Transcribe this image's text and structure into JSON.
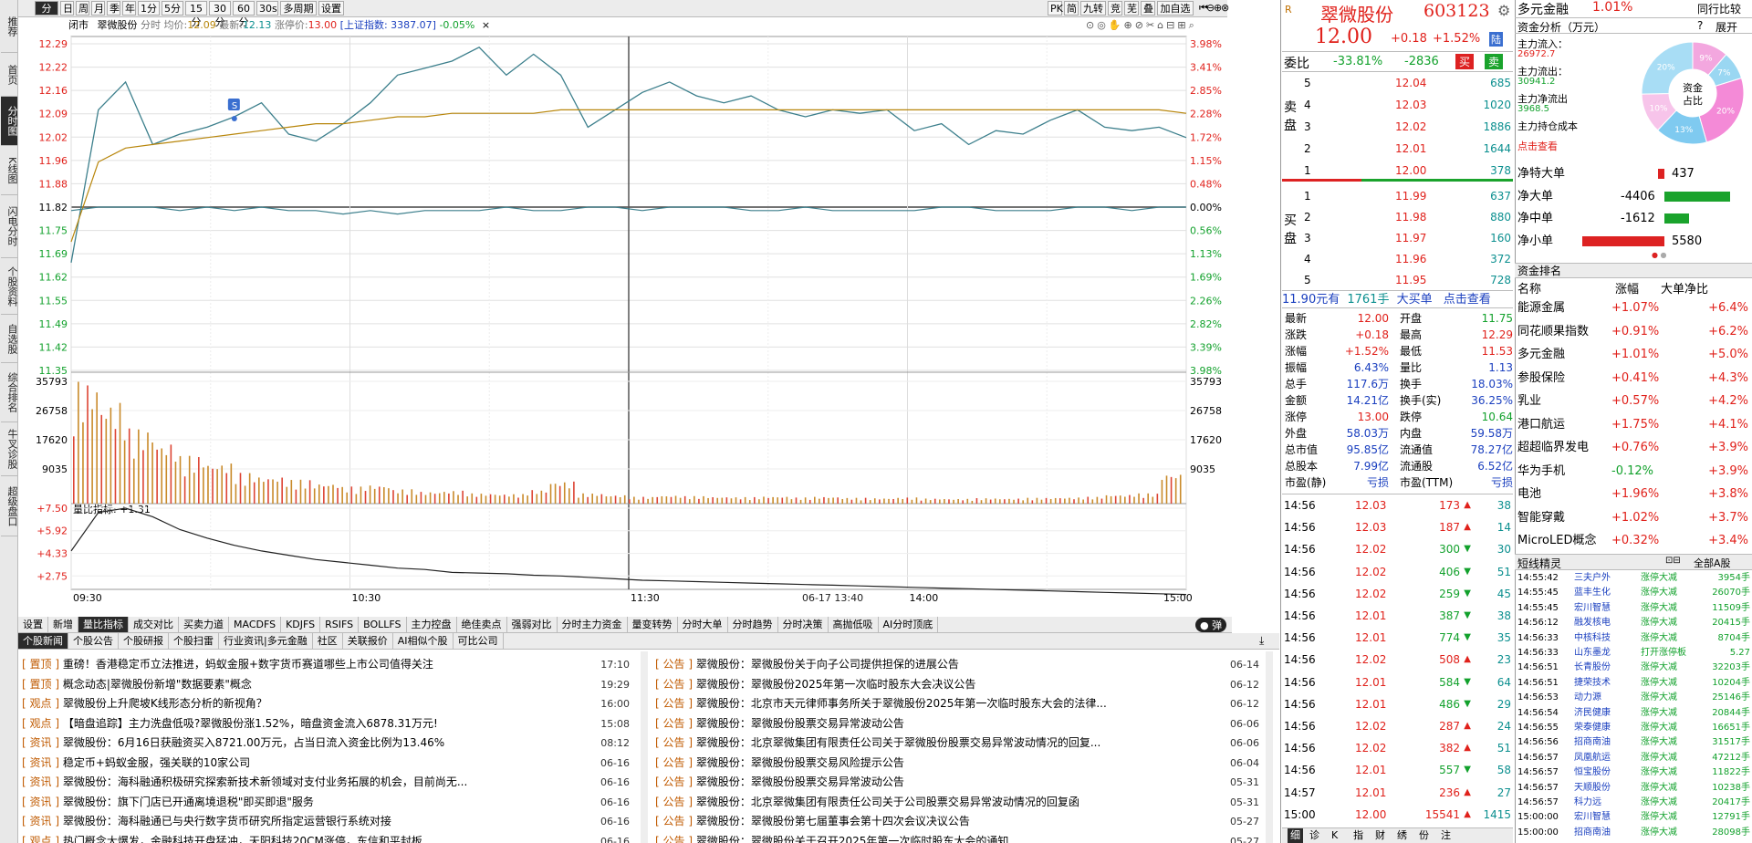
{
  "nav": {
    "tabs": [
      "推荐",
      "首页",
      "分时图",
      "K线图",
      "闪电分时",
      "个股资料",
      "自选股",
      "综合排名",
      "牛叉诊股",
      "超级盘口"
    ],
    "active": 2
  },
  "toolbar": {
    "periods": [
      "分时",
      "日",
      "周",
      "月",
      "季",
      "年",
      "1分",
      "5分",
      "15分",
      "30分",
      "60分",
      "30s",
      "多周期",
      "设置"
    ],
    "right": [
      "PK",
      "简",
      "九转",
      "竞",
      "芜",
      "叠",
      "加自选"
    ]
  },
  "chart_header": {
    "status": "闭市",
    "name": "翠微股份",
    "type": "分时",
    "avg_label": "均价:",
    "avg": "12.09",
    "last_label": "最新:",
    "last": "12.13",
    "limit_label": "涨停价:",
    "limit": "13.00",
    "index_text": "[上证指数: 3387.07]",
    "index_chg": "-0.05%",
    "close": "×"
  },
  "chart_data": [
    {
      "type": "line",
      "title": "分时",
      "x": [
        "09:30",
        "10:30",
        "11:30",
        "14:00",
        "15:00"
      ],
      "left_ticks": [
        "12.29",
        "12.22",
        "12.16",
        "12.09",
        "12.02",
        "11.96",
        "11.88",
        "11.82",
        "11.75",
        "11.69",
        "11.62",
        "11.55",
        "11.49",
        "11.42",
        "11.35"
      ],
      "right_ticks": [
        "3.98%",
        "3.41%",
        "2.85%",
        "2.28%",
        "1.72%",
        "1.15%",
        "0.48%",
        "0.00%",
        "0.56%",
        "1.13%",
        "1.69%",
        "2.26%",
        "2.82%",
        "3.39%",
        "3.98%"
      ],
      "ylim": [
        11.35,
        12.29
      ],
      "series": [
        {
          "name": "",
          "values": [
            11.66,
            12.1,
            12.18,
            12.0,
            12.03,
            12.05,
            12.08,
            12.12,
            12.03,
            12.01,
            12.06,
            12.12,
            12.2,
            12.22,
            12.24,
            12.28,
            12.2,
            12.26,
            12.2,
            12.05,
            12.1,
            12.15,
            12.18,
            12.14,
            12.12,
            12.14,
            12.1,
            12.08,
            12.1,
            12.09,
            12.1,
            12.04,
            12.06,
            12.0,
            12.04,
            12.03,
            12.07,
            12.1,
            12.05,
            12.04,
            12.05,
            12.02
          ]
        },
        {
          "name": "",
          "values": [
            11.72,
            11.95,
            11.99,
            12.0,
            12.01,
            12.02,
            12.03,
            12.04,
            12.05,
            12.06,
            12.06,
            12.07,
            12.08,
            12.08,
            12.09,
            12.09,
            12.09,
            12.09,
            12.1,
            12.1,
            12.1,
            12.1,
            12.1,
            12.1,
            12.1,
            12.1,
            12.1,
            12.1,
            12.1,
            12.1,
            12.1,
            12.1,
            12.1,
            12.1,
            12.1,
            12.1,
            12.1,
            12.1,
            12.1,
            12.1,
            12.1,
            12.09
          ]
        },
        {
          "name": "",
          "values": [
            11.81,
            11.82,
            11.82,
            11.82,
            11.81,
            11.82,
            11.81,
            11.82,
            11.81,
            11.81,
            11.8,
            11.81,
            11.8,
            11.81,
            11.81,
            11.81,
            11.82,
            11.81,
            11.81,
            11.82,
            11.82,
            11.81,
            11.82,
            11.82,
            11.82,
            11.81,
            11.81,
            11.82,
            11.81,
            11.81,
            11.81,
            11.81,
            11.82,
            11.82,
            11.81,
            11.81,
            11.81,
            11.82,
            11.82,
            11.81,
            11.82,
            11.82
          ]
        }
      ],
      "marker": "S"
    },
    {
      "type": "bar",
      "title": "成交量",
      "left_ticks": [
        "35793",
        "26758",
        "17620",
        "9035"
      ],
      "right_ticks": [
        "35793",
        "26758",
        "17620",
        "9035"
      ],
      "values": [
        35793,
        30000,
        22000,
        18000,
        14000,
        12000,
        9000,
        8000,
        7000,
        6000,
        5000,
        5500,
        4200,
        3500,
        3800,
        3000,
        2800,
        4000,
        6500,
        3000,
        2500,
        2000,
        2400,
        2200,
        2000,
        1900,
        2100,
        1800,
        2000,
        1700,
        1600,
        1800,
        1500,
        1400,
        1600,
        1500,
        1700,
        1800,
        2000,
        2600,
        3000,
        9000
      ]
    },
    {
      "type": "line",
      "title": "量比指标",
      "label": "量比指标: +1.31",
      "ticks": [
        "+7.50",
        "+5.92",
        "+4.33",
        "+2.75"
      ],
      "values": [
        4.5,
        7.2,
        7.5,
        6.9,
        6.0,
        5.4,
        4.9,
        4.5,
        4.2,
        3.9,
        3.7,
        3.5,
        3.3,
        3.2,
        3.0,
        2.95,
        2.9,
        2.8,
        2.75,
        2.65,
        2.55,
        2.45,
        2.4,
        2.35,
        2.3,
        2.25,
        2.2,
        2.15,
        2.1,
        2.05,
        2.0,
        1.95,
        1.9,
        1.85,
        1.8,
        1.75,
        1.7,
        1.65,
        1.6,
        1.55,
        1.5,
        1.45
      ]
    }
  ],
  "time_labels": [
    "09:30",
    "10:30",
    "11:30",
    "06-17 13:40",
    "14:00",
    "15:00"
  ],
  "indicator_tabs": [
    "设置",
    "新增",
    "量比指标",
    "成交对比",
    "买卖力道",
    "MACDFS",
    "KDJFS",
    "RSIFS",
    "BOLLFS",
    "主力控盘",
    "绝佳卖点",
    "强弱对比",
    "分时主力资金",
    "量变转势",
    "分时大单",
    "分时趋势",
    "分时决策",
    "高抛低吸",
    "AI分时顶底"
  ],
  "news_tabs": [
    "个股新闻",
    "个股公告",
    "个股研报",
    "个股扫雷",
    "行业资讯|多元金融",
    "社区",
    "关联报价",
    "AI相似个股",
    "可比公司"
  ],
  "news_left": [
    {
      "tag": "置顶",
      "text": "重磅！香港稳定币立法推进，蚂蚁金服+数字货币赛道哪些上市公司值得关注",
      "date": "17:10"
    },
    {
      "tag": "置顶",
      "text": "概念动态|翠微股份新增\"数据要素\"概念",
      "date": "19:29"
    },
    {
      "tag": "观点",
      "text": "翠微股份上升爬坡K线形态分析的新视角？",
      "date": "16:00"
    },
    {
      "tag": "观点",
      "text": "【暗盘追踪】主力洗盘低吸?翠微股份涨1.52%，暗盘资金流入6878.31万元!",
      "date": "15:08"
    },
    {
      "tag": "资讯",
      "text": "翠微股份：6月16日获融资买入8721.00万元，占当日流入资金比例为13.46%",
      "date": "08:12"
    },
    {
      "tag": "资讯",
      "text": "稳定币+蚂蚁金服，强关联的10家公司",
      "date": "06-16"
    },
    {
      "tag": "资讯",
      "text": "翠微股份：海科融通积极研究探索新技术新领域对支付业务拓展的机会，目前尚无...",
      "date": "06-16"
    },
    {
      "tag": "资讯",
      "text": "翠微股份：旗下门店已开通离境退税\"即买即退\"服务",
      "date": "06-16"
    },
    {
      "tag": "资讯",
      "text": "翠微股份：海科融通已与央行数字货币研究所指定运营银行系统对接",
      "date": "06-16"
    },
    {
      "tag": "观点",
      "text": "热门概念大爆发，金融科技开盘猛冲，天阳科技20CM涨停，东信和平封板",
      "date": "06-16"
    }
  ],
  "news_right": [
    {
      "tag": "公告",
      "text": "翠微股份：翠微股份关于向子公司提供担保的进展公告",
      "date": "06-14"
    },
    {
      "tag": "公告",
      "text": "翠微股份：翠微股份2025年第一次临时股东大会决议公告",
      "date": "06-12"
    },
    {
      "tag": "公告",
      "text": "翠微股份：北京市天元律师事务所关于翠微股份2025年第一次临时股东大会的法律...",
      "date": "06-12"
    },
    {
      "tag": "公告",
      "text": "翠微股份：翠微股份股票交易异常波动公告",
      "date": "06-06"
    },
    {
      "tag": "公告",
      "text": "翠微股份：北京翠微集团有限责任公司关于翠微股份股票交易异常波动情况的回复...",
      "date": "06-06"
    },
    {
      "tag": "公告",
      "text": "翠微股份：翠微股份股票交易风险提示公告",
      "date": "06-04"
    },
    {
      "tag": "公告",
      "text": "翠微股份：翠微股份股票交易异常波动公告",
      "date": "05-31"
    },
    {
      "tag": "公告",
      "text": "翠微股份：北京翠微集团有限责任公司关于公司股票交易异常波动情况的回复函",
      "date": "05-31"
    },
    {
      "tag": "公告",
      "text": "翠微股份：翠微股份第七届董事会第十四次会议决议公告",
      "date": "05-27"
    },
    {
      "tag": "公告",
      "text": "翠微股份：翠微股份关于召开2025年第一次临时股东大会的通知",
      "date": "05-27"
    }
  ],
  "quote": {
    "r": "R",
    "name": "翠微股份",
    "code": "603123",
    "price": "12.00",
    "chg": "+0.18",
    "pct": "+1.52%",
    "tag": "陆",
    "wb_label": "委比",
    "wb": "-33.81%",
    "wc": "-2836",
    "buy_btn": "买",
    "sell_btn": "卖",
    "sell_label": "卖盘",
    "buy_label": "买盘",
    "asks": [
      {
        "n": "5",
        "p": "12.04",
        "v": "685"
      },
      {
        "n": "4",
        "p": "12.03",
        "v": "1020"
      },
      {
        "n": "3",
        "p": "12.02",
        "v": "1886"
      },
      {
        "n": "2",
        "p": "12.01",
        "v": "1644"
      },
      {
        "n": "1",
        "p": "12.00",
        "v": "378"
      }
    ],
    "bids": [
      {
        "n": "1",
        "p": "11.99",
        "v": "637"
      },
      {
        "n": "2",
        "p": "11.98",
        "v": "880"
      },
      {
        "n": "3",
        "p": "11.97",
        "v": "160"
      },
      {
        "n": "4",
        "p": "11.96",
        "v": "372"
      },
      {
        "n": "5",
        "p": "11.95",
        "v": "728"
      }
    ],
    "bigorder": {
      "price": "11.90元有",
      "qty": "1761手",
      "type": "大买单",
      "link": "点击查看"
    },
    "stats": [
      [
        "最新",
        "12.00",
        "开盘",
        "11.75"
      ],
      [
        "涨跌",
        "+0.18",
        "最高",
        "12.29"
      ],
      [
        "涨幅",
        "+1.52%",
        "最低",
        "11.53"
      ],
      [
        "振幅",
        "6.43%",
        "量比",
        "1.13"
      ],
      [
        "总手",
        "117.6万",
        "换手",
        "18.03%"
      ],
      [
        "金额",
        "14.21亿",
        "换手(实)",
        "36.25%"
      ],
      [
        "涨停",
        "13.00",
        "跌停",
        "10.64"
      ],
      [
        "外盘",
        "58.03万",
        "内盘",
        "59.58万"
      ],
      [
        "总市值",
        "95.85亿",
        "流通值",
        "78.27亿"
      ],
      [
        "总股本",
        "7.99亿",
        "流通股",
        "6.52亿"
      ],
      [
        "市盈(静)",
        "亏损",
        "市盈(TTM)",
        "亏损"
      ]
    ],
    "ticks": [
      {
        "t": "14:56",
        "p": "12.03",
        "v": "173",
        "d": "up",
        "n": "38"
      },
      {
        "t": "14:56",
        "p": "12.03",
        "v": "187",
        "d": "up",
        "n": "14"
      },
      {
        "t": "14:56",
        "p": "12.02",
        "v": "300",
        "d": "down",
        "n": "30"
      },
      {
        "t": "14:56",
        "p": "12.02",
        "v": "406",
        "d": "down",
        "n": "51"
      },
      {
        "t": "14:56",
        "p": "12.02",
        "v": "259",
        "d": "down",
        "n": "45"
      },
      {
        "t": "14:56",
        "p": "12.01",
        "v": "387",
        "d": "down",
        "n": "38"
      },
      {
        "t": "14:56",
        "p": "12.01",
        "v": "774",
        "d": "down",
        "n": "35"
      },
      {
        "t": "14:56",
        "p": "12.02",
        "v": "508",
        "d": "up",
        "n": "23"
      },
      {
        "t": "14:56",
        "p": "12.01",
        "v": "584",
        "d": "down",
        "n": "64"
      },
      {
        "t": "14:56",
        "p": "12.01",
        "v": "486",
        "d": "down",
        "n": "29"
      },
      {
        "t": "14:56",
        "p": "12.02",
        "v": "287",
        "d": "up",
        "n": "24"
      },
      {
        "t": "14:56",
        "p": "12.02",
        "v": "382",
        "d": "up",
        "n": "51"
      },
      {
        "t": "14:56",
        "p": "12.01",
        "v": "557",
        "d": "down",
        "n": "58"
      },
      {
        "t": "14:57",
        "p": "12.01",
        "v": "236",
        "d": "up",
        "n": "27"
      },
      {
        "t": "15:00",
        "p": "12.00",
        "v": "15541",
        "d": "up",
        "n": "1415"
      }
    ],
    "bottom_tabs": [
      "细",
      "诊",
      "K",
      "指",
      "财",
      "绣",
      "份",
      "注"
    ]
  },
  "fund": {
    "sector": "多元金融",
    "sector_pct": "1.01%",
    "peer": "同行比较",
    "title": "资金分析（万元）",
    "q": "?",
    "expand": "展开",
    "rows": [
      [
        "主力流入：",
        "26972.7"
      ],
      [
        "主力流出：",
        "30941.2"
      ],
      [
        "主力净流出",
        "3968.5"
      ],
      [
        "主力持仓成本",
        ""
      ]
    ],
    "link": "点击查看",
    "donut_label": "资金占比",
    "donut": [
      {
        "v": "9%",
        "c": "#f3a7df"
      },
      {
        "v": "7%",
        "c": "#9ad7f2"
      },
      {
        "v": "20%",
        "c": "#f48ad7"
      },
      {
        "v": "13%",
        "c": "#7fcaf0"
      },
      {
        "v": "10%",
        "c": "#f7c4ea"
      },
      {
        "v": "20%",
        "c": "#a8ddf5"
      }
    ],
    "net": [
      {
        "k": "净特大单",
        "v": "437",
        "w": 0.08,
        "c": "#d22"
      },
      {
        "k": "净大单",
        "v": "-4406",
        "w": 0.8,
        "c": "#1aa32c"
      },
      {
        "k": "净中单",
        "v": "-1612",
        "w": 0.3,
        "c": "#1aa32c"
      },
      {
        "k": "净小单",
        "v": "5580",
        "w": 1.0,
        "c": "#d22"
      }
    ],
    "rank_title": "资金排名",
    "rank_head": [
      "名称",
      "涨幅",
      "大单净比"
    ],
    "rank": [
      [
        "能源金属",
        "+1.07%",
        "+6.4%"
      ],
      [
        "同花顺果指数",
        "+0.91%",
        "+6.2%"
      ],
      [
        "多元金融",
        "+1.01%",
        "+5.0%"
      ],
      [
        "参股保险",
        "+0.41%",
        "+4.3%"
      ],
      [
        "乳业",
        "+0.57%",
        "+4.2%"
      ],
      [
        "港口航运",
        "+1.75%",
        "+4.1%"
      ],
      [
        "超超临界发电",
        "+0.76%",
        "+3.9%"
      ],
      [
        "华为手机",
        "-0.12%",
        "+3.9%"
      ],
      [
        "电池",
        "+1.96%",
        "+3.8%"
      ],
      [
        "智能穿戴",
        "+1.02%",
        "+3.7%"
      ],
      [
        "MicroLED概念",
        "+0.32%",
        "+3.4%"
      ]
    ],
    "short_title": "短线精灵",
    "short_filter": "全部A股",
    "short": [
      [
        "14:55:42",
        "三夫户外",
        "涨停大减",
        "3954手"
      ],
      [
        "14:55:45",
        "蓝丰生化",
        "涨停大减",
        "26070手"
      ],
      [
        "14:55:45",
        "宏川智慧",
        "涨停大减",
        "11509手"
      ],
      [
        "14:56:12",
        "融发核电",
        "涨停大减",
        "20415手"
      ],
      [
        "14:56:33",
        "中核科技",
        "涨停大减",
        "8704手"
      ],
      [
        "14:56:33",
        "山东墨龙",
        "打开涨停板",
        "5.27"
      ],
      [
        "14:56:51",
        "长青股份",
        "涨停大减",
        "32203手"
      ],
      [
        "14:56:51",
        "捷荣技术",
        "涨停大减",
        "10204手"
      ],
      [
        "14:56:53",
        "动力源",
        "涨停大减",
        "25146手"
      ],
      [
        "14:56:54",
        "济民健康",
        "涨停大减",
        "20844手"
      ],
      [
        "14:56:55",
        "荣泰健康",
        "涨停大减",
        "16651手"
      ],
      [
        "14:56:56",
        "招商南油",
        "涨停大减",
        "31517手"
      ],
      [
        "14:56:57",
        "凤凰航运",
        "涨停大减",
        "47212手"
      ],
      [
        "14:56:57",
        "恒宝股份",
        "涨停大减",
        "11822手"
      ],
      [
        "14:56:57",
        "天顺股份",
        "涨停大减",
        "10238手"
      ],
      [
        "14:56:57",
        "科力远",
        "涨停大减",
        "20417手"
      ],
      [
        "15:00:00",
        "宏川智慧",
        "涨停大减",
        "12791手"
      ],
      [
        "15:00:00",
        "招商南油",
        "涨停大减",
        "28098手"
      ]
    ]
  }
}
